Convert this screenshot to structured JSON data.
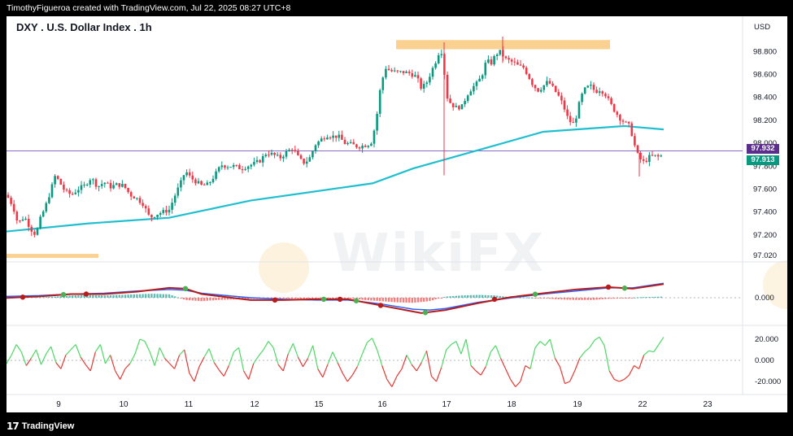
{
  "header": {
    "credit": "TimothyFigueroa created with TradingView.com, Jul 22, 2025 08:27 UTC+8"
  },
  "footer": {
    "logo_text": "TradingView",
    "logo_mark": "17"
  },
  "panel": {
    "title": "DXY . U.S. Dollar Index . 1h",
    "currency": "USD",
    "last_price_tag": "97.932",
    "close_tag": "97.913",
    "watermark": "WikiFX"
  },
  "colors": {
    "up": "#089981",
    "down": "#f23645",
    "ma": "#1fbfcf",
    "highlight": "#f9c97d",
    "tag_purple": "#5b2d8c"
  },
  "chart_data": [
    {
      "type": "candlestick",
      "title": "DXY . U.S. Dollar Index . 1h",
      "y_ticks": [
        "98.800",
        "98.600",
        "98.400",
        "98.200",
        "98.000",
        "97.800",
        "97.600",
        "97.400",
        "97.200",
        "97.020"
      ],
      "x_ticks": [
        "9",
        "10",
        "11",
        "12",
        "15",
        "16",
        "17",
        "18",
        "19",
        "22",
        "23"
      ],
      "ylim": [
        97.0,
        98.93
      ],
      "price_path": [
        [
          0,
          97.55
        ],
        [
          8,
          97.45
        ],
        [
          14,
          97.3
        ],
        [
          22,
          97.36
        ],
        [
          30,
          97.25
        ],
        [
          36,
          97.2
        ],
        [
          42,
          97.35
        ],
        [
          48,
          97.45
        ],
        [
          54,
          97.58
        ],
        [
          60,
          97.72
        ],
        [
          66,
          97.65
        ],
        [
          72,
          97.58
        ],
        [
          80,
          97.55
        ],
        [
          88,
          97.6
        ],
        [
          96,
          97.63
        ],
        [
          104,
          97.7
        ],
        [
          112,
          97.62
        ],
        [
          120,
          97.66
        ],
        [
          128,
          97.62
        ],
        [
          136,
          97.64
        ],
        [
          144,
          97.63
        ],
        [
          152,
          97.55
        ],
        [
          160,
          97.52
        ],
        [
          168,
          97.47
        ],
        [
          176,
          97.35
        ],
        [
          184,
          97.38
        ],
        [
          192,
          97.4
        ],
        [
          200,
          97.42
        ],
        [
          208,
          97.56
        ],
        [
          214,
          97.65
        ],
        [
          220,
          97.76
        ],
        [
          226,
          97.7
        ],
        [
          232,
          97.67
        ],
        [
          240,
          97.63
        ],
        [
          248,
          97.64
        ],
        [
          256,
          97.72
        ],
        [
          264,
          97.81
        ],
        [
          272,
          97.8
        ],
        [
          280,
          97.8
        ],
        [
          288,
          97.78
        ],
        [
          296,
          97.8
        ],
        [
          304,
          97.82
        ],
        [
          312,
          97.85
        ],
        [
          320,
          97.92
        ],
        [
          328,
          97.9
        ],
        [
          336,
          97.87
        ],
        [
          344,
          97.92
        ],
        [
          352,
          97.96
        ],
        [
          360,
          97.86
        ],
        [
          366,
          97.83
        ],
        [
          372,
          97.86
        ],
        [
          380,
          97.99
        ],
        [
          388,
          98.04
        ],
        [
          394,
          98.07
        ],
        [
          400,
          98.06
        ],
        [
          408,
          98.06
        ],
        [
          416,
          98.0
        ],
        [
          424,
          97.99
        ],
        [
          432,
          97.97
        ],
        [
          440,
          97.98
        ],
        [
          448,
          98.0
        ],
        [
          454,
          98.17
        ],
        [
          460,
          98.5
        ],
        [
          466,
          98.66
        ],
        [
          472,
          98.63
        ],
        [
          480,
          98.62
        ],
        [
          488,
          98.62
        ],
        [
          496,
          98.61
        ],
        [
          504,
          98.58
        ],
        [
          510,
          98.48
        ],
        [
          516,
          98.52
        ],
        [
          522,
          98.62
        ],
        [
          528,
          98.72
        ],
        [
          534,
          98.84
        ],
        [
          538,
          98.63
        ],
        [
          542,
          98.4
        ],
        [
          546,
          98.35
        ],
        [
          552,
          98.31
        ],
        [
          560,
          98.32
        ],
        [
          566,
          98.42
        ],
        [
          572,
          98.48
        ],
        [
          578,
          98.52
        ],
        [
          584,
          98.58
        ],
        [
          590,
          98.72
        ],
        [
          596,
          98.7
        ],
        [
          602,
          98.78
        ],
        [
          608,
          98.8
        ],
        [
          612,
          98.74
        ],
        [
          618,
          98.72
        ],
        [
          624,
          98.7
        ],
        [
          630,
          98.67
        ],
        [
          636,
          98.66
        ],
        [
          642,
          98.58
        ],
        [
          648,
          98.5
        ],
        [
          654,
          98.46
        ],
        [
          660,
          98.5
        ],
        [
          666,
          98.54
        ],
        [
          672,
          98.48
        ],
        [
          678,
          98.42
        ],
        [
          684,
          98.34
        ],
        [
          690,
          98.22
        ],
        [
          696,
          98.16
        ],
        [
          700,
          98.22
        ],
        [
          706,
          98.4
        ],
        [
          712,
          98.48
        ],
        [
          718,
          98.5
        ],
        [
          724,
          98.45
        ],
        [
          730,
          98.47
        ],
        [
          736,
          98.43
        ],
        [
          742,
          98.35
        ],
        [
          748,
          98.28
        ],
        [
          754,
          98.22
        ],
        [
          760,
          98.18
        ],
        [
          766,
          98.15
        ],
        [
          770,
          98.05
        ],
        [
          774,
          97.93
        ],
        [
          778,
          97.87
        ],
        [
          784,
          97.83
        ],
        [
          790,
          97.88
        ],
        [
          796,
          97.89
        ],
        [
          802,
          97.88
        ],
        [
          808,
          97.9
        ]
      ],
      "spikes": [
        {
          "x": 538,
          "high": 98.88,
          "low": 97.72
        },
        {
          "x": 610,
          "high": 98.93,
          "low": 98.7
        },
        {
          "x": 778,
          "high": 97.92,
          "low": 97.71
        }
      ],
      "ma_path": [
        [
          0,
          97.23
        ],
        [
          100,
          97.3
        ],
        [
          200,
          97.35
        ],
        [
          300,
          97.5
        ],
        [
          400,
          97.6
        ],
        [
          450,
          97.65
        ],
        [
          500,
          97.78
        ],
        [
          540,
          97.86
        ],
        [
          600,
          97.98
        ],
        [
          660,
          98.1
        ],
        [
          720,
          98.13
        ],
        [
          760,
          98.15
        ],
        [
          808,
          98.12
        ]
      ],
      "highlight_zones": [
        {
          "x0": 479,
          "x1": 742,
          "y0": 98.82,
          "y1": 98.9
        },
        {
          "x0": 0,
          "x1": 113,
          "y0": 97.0,
          "y1": 97.035
        }
      ],
      "horizontal_lines": [
        97.933
      ]
    },
    {
      "type": "line",
      "title": "",
      "series": [
        {
          "points": [
            [
              0,
              2
            ],
            [
              40,
              4
            ],
            [
              80,
              7
            ],
            [
              120,
              7
            ],
            [
              160,
              10
            ],
            [
              200,
              15
            ],
            [
              220,
              14
            ],
            [
              240,
              7
            ],
            [
              300,
              -3
            ],
            [
              340,
              -3
            ],
            [
              380,
              -2
            ],
            [
              420,
              -2
            ],
            [
              460,
              -10
            ],
            [
              500,
              -18
            ],
            [
              510,
              -20
            ],
            [
              540,
              -16
            ],
            [
              580,
              -7
            ],
            [
              620,
              3
            ],
            [
              660,
              8
            ],
            [
              700,
              13
            ],
            [
              740,
              16
            ],
            [
              770,
              14
            ],
            [
              808,
              20
            ]
          ]
        },
        {
          "points": [
            [
              0,
              4
            ],
            [
              40,
              5
            ],
            [
              80,
              7
            ],
            [
              120,
              8
            ],
            [
              160,
              11
            ],
            [
              200,
              13
            ],
            [
              220,
              12
            ],
            [
              240,
              8
            ],
            [
              300,
              0
            ],
            [
              340,
              -2
            ],
            [
              380,
              -3
            ],
            [
              420,
              -3
            ],
            [
              460,
              -8
            ],
            [
              500,
              -15
            ],
            [
              520,
              -16
            ],
            [
              540,
              -14
            ],
            [
              580,
              -6
            ],
            [
              620,
              2
            ],
            [
              660,
              7
            ],
            [
              700,
              11
            ],
            [
              740,
              15
            ],
            [
              770,
              15
            ],
            [
              808,
              21
            ]
          ]
        }
      ],
      "histogram": [
        [
          0,
          1
        ],
        [
          20,
          1.5
        ],
        [
          40,
          0.5
        ],
        [
          60,
          1
        ],
        [
          80,
          2
        ],
        [
          100,
          2.5
        ],
        [
          120,
          2
        ],
        [
          140,
          2.5
        ],
        [
          160,
          3
        ],
        [
          180,
          3.5
        ],
        [
          200,
          3
        ],
        [
          220,
          -2
        ],
        [
          240,
          -3
        ],
        [
          260,
          -2
        ],
        [
          280,
          -1.5
        ],
        [
          300,
          -1
        ],
        [
          320,
          -1
        ],
        [
          340,
          -0.5
        ],
        [
          360,
          -1
        ],
        [
          380,
          -0.5
        ],
        [
          400,
          -1
        ],
        [
          420,
          -0.5
        ],
        [
          440,
          -2
        ],
        [
          460,
          -3
        ],
        [
          480,
          -4
        ],
        [
          500,
          -4.5
        ],
        [
          520,
          -3
        ],
        [
          540,
          1
        ],
        [
          560,
          2
        ],
        [
          580,
          2.5
        ],
        [
          600,
          2
        ],
        [
          620,
          0.5
        ],
        [
          640,
          0.3
        ],
        [
          660,
          -0.5
        ],
        [
          680,
          -1.5
        ],
        [
          700,
          -2
        ],
        [
          720,
          -2
        ],
        [
          740,
          -1
        ],
        [
          760,
          -0.5
        ],
        [
          780,
          0.5
        ],
        [
          808,
          1
        ]
      ],
      "dots": [
        20,
        70,
        98,
        220,
        330,
        390,
        410,
        430,
        460,
        515,
        600,
        650,
        740,
        760
      ],
      "zero_label": "0.000",
      "ylim": [
        -12,
        -4
      ]
    },
    {
      "type": "line",
      "title": "",
      "y_ticks": [
        "20.000",
        "0.000",
        "-20.000"
      ],
      "ylim": [
        -30,
        30
      ],
      "values": [
        -3,
        5,
        15,
        8,
        -5,
        2,
        10,
        -4,
        6,
        13,
        -2,
        -8,
        5,
        10,
        15,
        3,
        -4,
        -10,
        8,
        15,
        -3,
        5,
        -10,
        -18,
        -8,
        -3,
        6,
        20,
        18,
        8,
        -5,
        12,
        2,
        -3,
        -8,
        5,
        10,
        -12,
        -20,
        -6,
        3,
        11,
        -2,
        -9,
        -15,
        -5,
        8,
        12,
        -10,
        -18,
        -3,
        4,
        10,
        18,
        12,
        -4,
        -10,
        6,
        16,
        3,
        -6,
        2,
        14,
        -8,
        -16,
        -4,
        8,
        -2,
        -12,
        -20,
        -14,
        -6,
        6,
        17,
        21,
        10,
        -5,
        -18,
        -25,
        -15,
        -8,
        5,
        -4,
        -10,
        -2,
        9,
        -15,
        -20,
        -7,
        10,
        15,
        18,
        6,
        20,
        -5,
        -10,
        -14,
        -6,
        8,
        14,
        2,
        -8,
        -18,
        -25,
        -20,
        -5,
        -8,
        12,
        18,
        14,
        20,
        2,
        -6,
        -22,
        -20,
        -10,
        2,
        8,
        12,
        19,
        22,
        14,
        -10,
        -18,
        -20,
        -18,
        -14,
        -5,
        -8,
        5,
        9,
        8,
        15,
        22
      ]
    }
  ]
}
